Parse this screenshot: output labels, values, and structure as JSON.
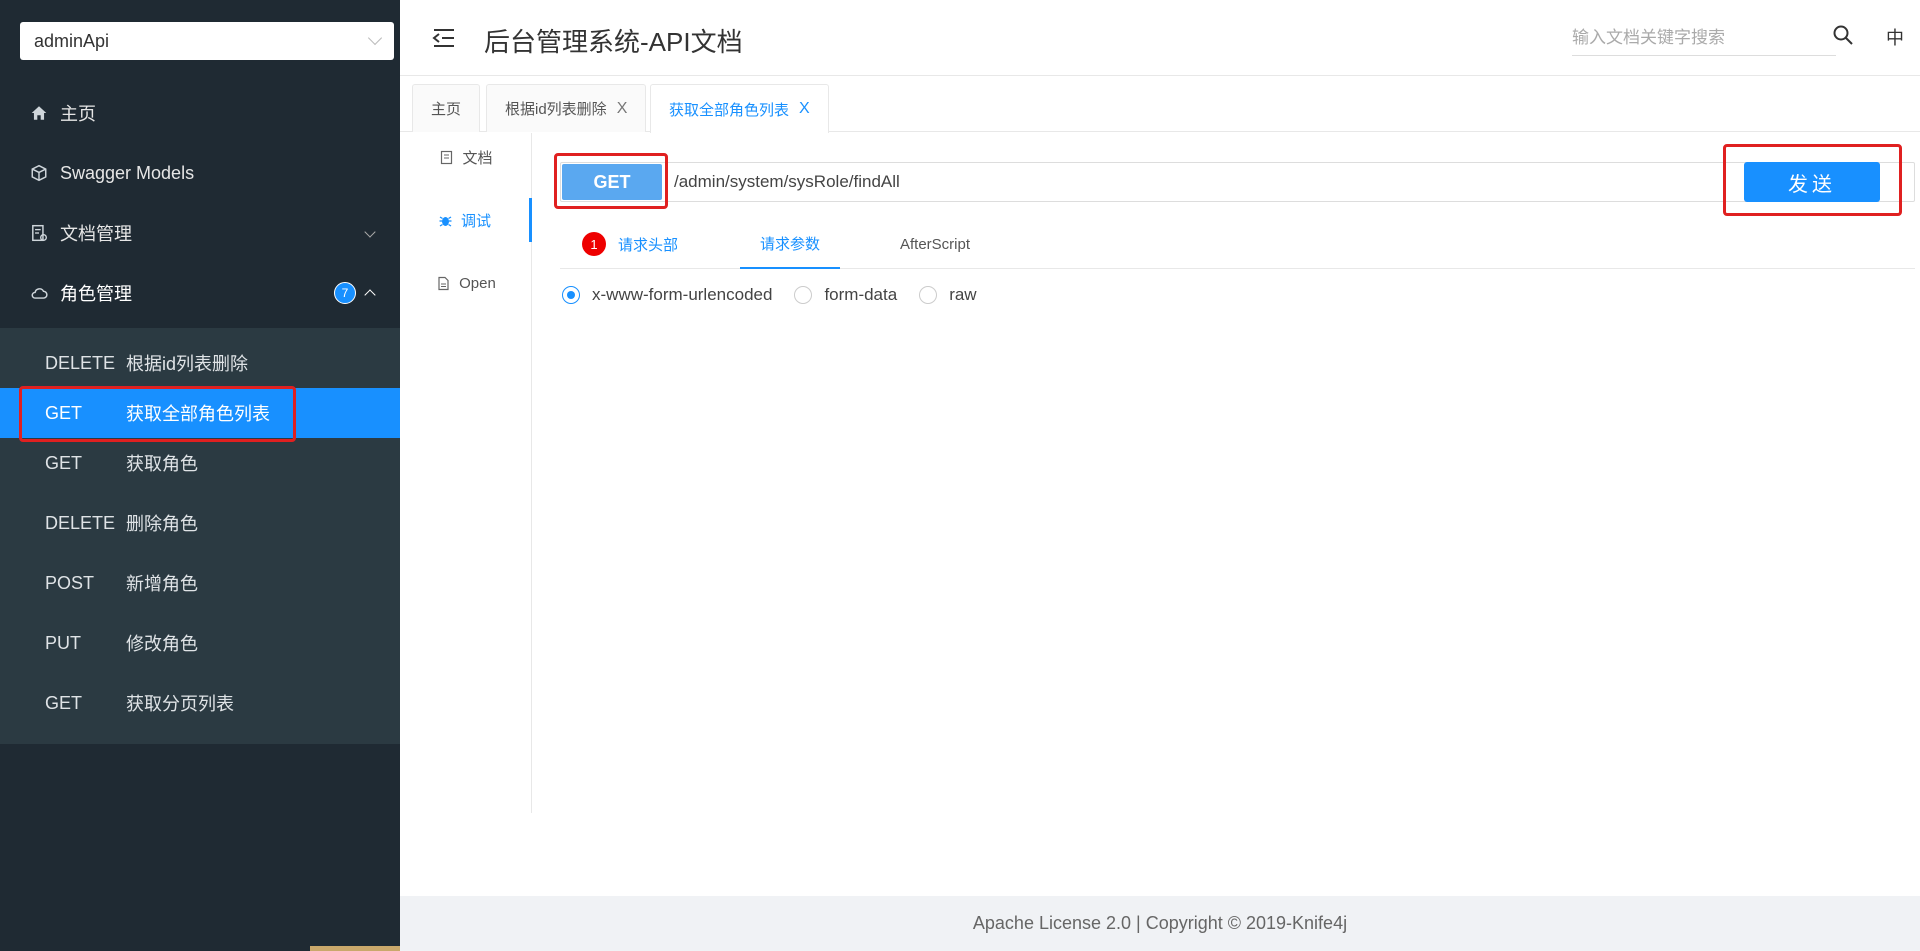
{
  "sidebar": {
    "group_select": "adminApi",
    "menu": [
      {
        "label": "主页",
        "icon": "home-icon"
      },
      {
        "label": "Swagger Models",
        "icon": "cube-icon"
      },
      {
        "label": "文档管理",
        "icon": "doc-manage-icon"
      },
      {
        "label": "角色管理",
        "icon": "cloud-icon",
        "badge": "7"
      }
    ],
    "submenu": [
      {
        "method": "DELETE",
        "name": "根据id列表删除"
      },
      {
        "method": "GET",
        "name": "获取全部角色列表",
        "active": true
      },
      {
        "method": "GET",
        "name": "获取角色"
      },
      {
        "method": "DELETE",
        "name": "删除角色"
      },
      {
        "method": "POST",
        "name": "新增角色"
      },
      {
        "method": "PUT",
        "name": "修改角色"
      },
      {
        "method": "GET",
        "name": "获取分页列表"
      }
    ]
  },
  "header": {
    "title": "后台管理系统-API文档",
    "search_placeholder": "输入文档关键字搜索",
    "lang": "中"
  },
  "tabs": [
    {
      "label": "主页",
      "closable": false
    },
    {
      "label": "根据id列表删除",
      "closable": true
    },
    {
      "label": "获取全部角色列表",
      "closable": true,
      "active": true
    }
  ],
  "close_glyph": "X",
  "vtabs": [
    {
      "label": "文档",
      "icon": "document-icon"
    },
    {
      "label": "调试",
      "icon": "bug-icon",
      "active": true
    },
    {
      "label": "Open",
      "icon": "file-icon"
    }
  ],
  "request": {
    "method": "GET",
    "url": "/admin/system/sysRole/findAll",
    "send_label": "发送"
  },
  "subtabs": [
    {
      "label": "请求头部",
      "badge": "1"
    },
    {
      "label": "请求参数",
      "active": true
    },
    {
      "label": "AfterScript"
    }
  ],
  "body_types": [
    {
      "label": "x-www-form-urlencoded",
      "checked": true
    },
    {
      "label": "form-data",
      "checked": false
    },
    {
      "label": "raw",
      "checked": false
    }
  ],
  "footer": {
    "text": "Apache License 2.0 | Copyright © 2019-Knife4j"
  },
  "colors": {
    "sidebar_bg": "#1f2a33",
    "submenu_bg": "#2b3a42",
    "accent": "#1890ff",
    "highlight_box": "#e02020"
  }
}
